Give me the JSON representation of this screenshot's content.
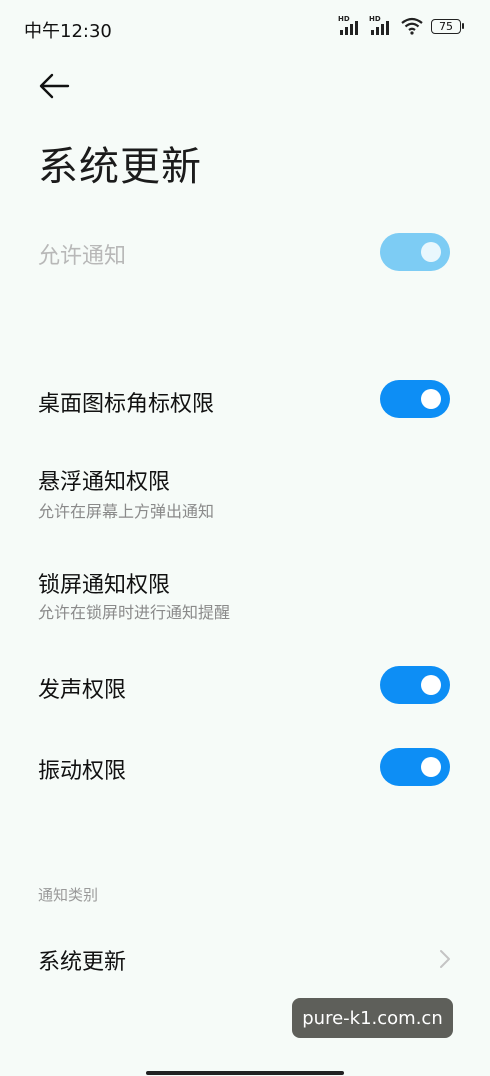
{
  "status_bar": {
    "time": "中午12:30",
    "signal1_label": "HD",
    "signal2_label": "HD",
    "battery": "75"
  },
  "page": {
    "title": "系统更新"
  },
  "settings": {
    "allow_notifications": {
      "label": "允许通知",
      "enabled": true,
      "disabled_state": true
    },
    "badge_permission": {
      "label": "桌面图标角标权限",
      "enabled": true
    },
    "floating_notification": {
      "label": "悬浮通知权限",
      "subtitle": "允许在屏幕上方弹出通知"
    },
    "lockscreen_notification": {
      "label": "锁屏通知权限",
      "subtitle": "允许在锁屏时进行通知提醒"
    },
    "sound_permission": {
      "label": "发声权限",
      "enabled": true
    },
    "vibration_permission": {
      "label": "振动权限",
      "enabled": true
    }
  },
  "categories": {
    "header": "通知类别",
    "items": [
      {
        "label": "系统更新"
      }
    ]
  },
  "watermark": {
    "text": "pure-k1.com.cn"
  },
  "colors": {
    "accent": "#0d8ef5",
    "accent_disabled": "#7dccf4",
    "background": "#f6fbf8"
  }
}
